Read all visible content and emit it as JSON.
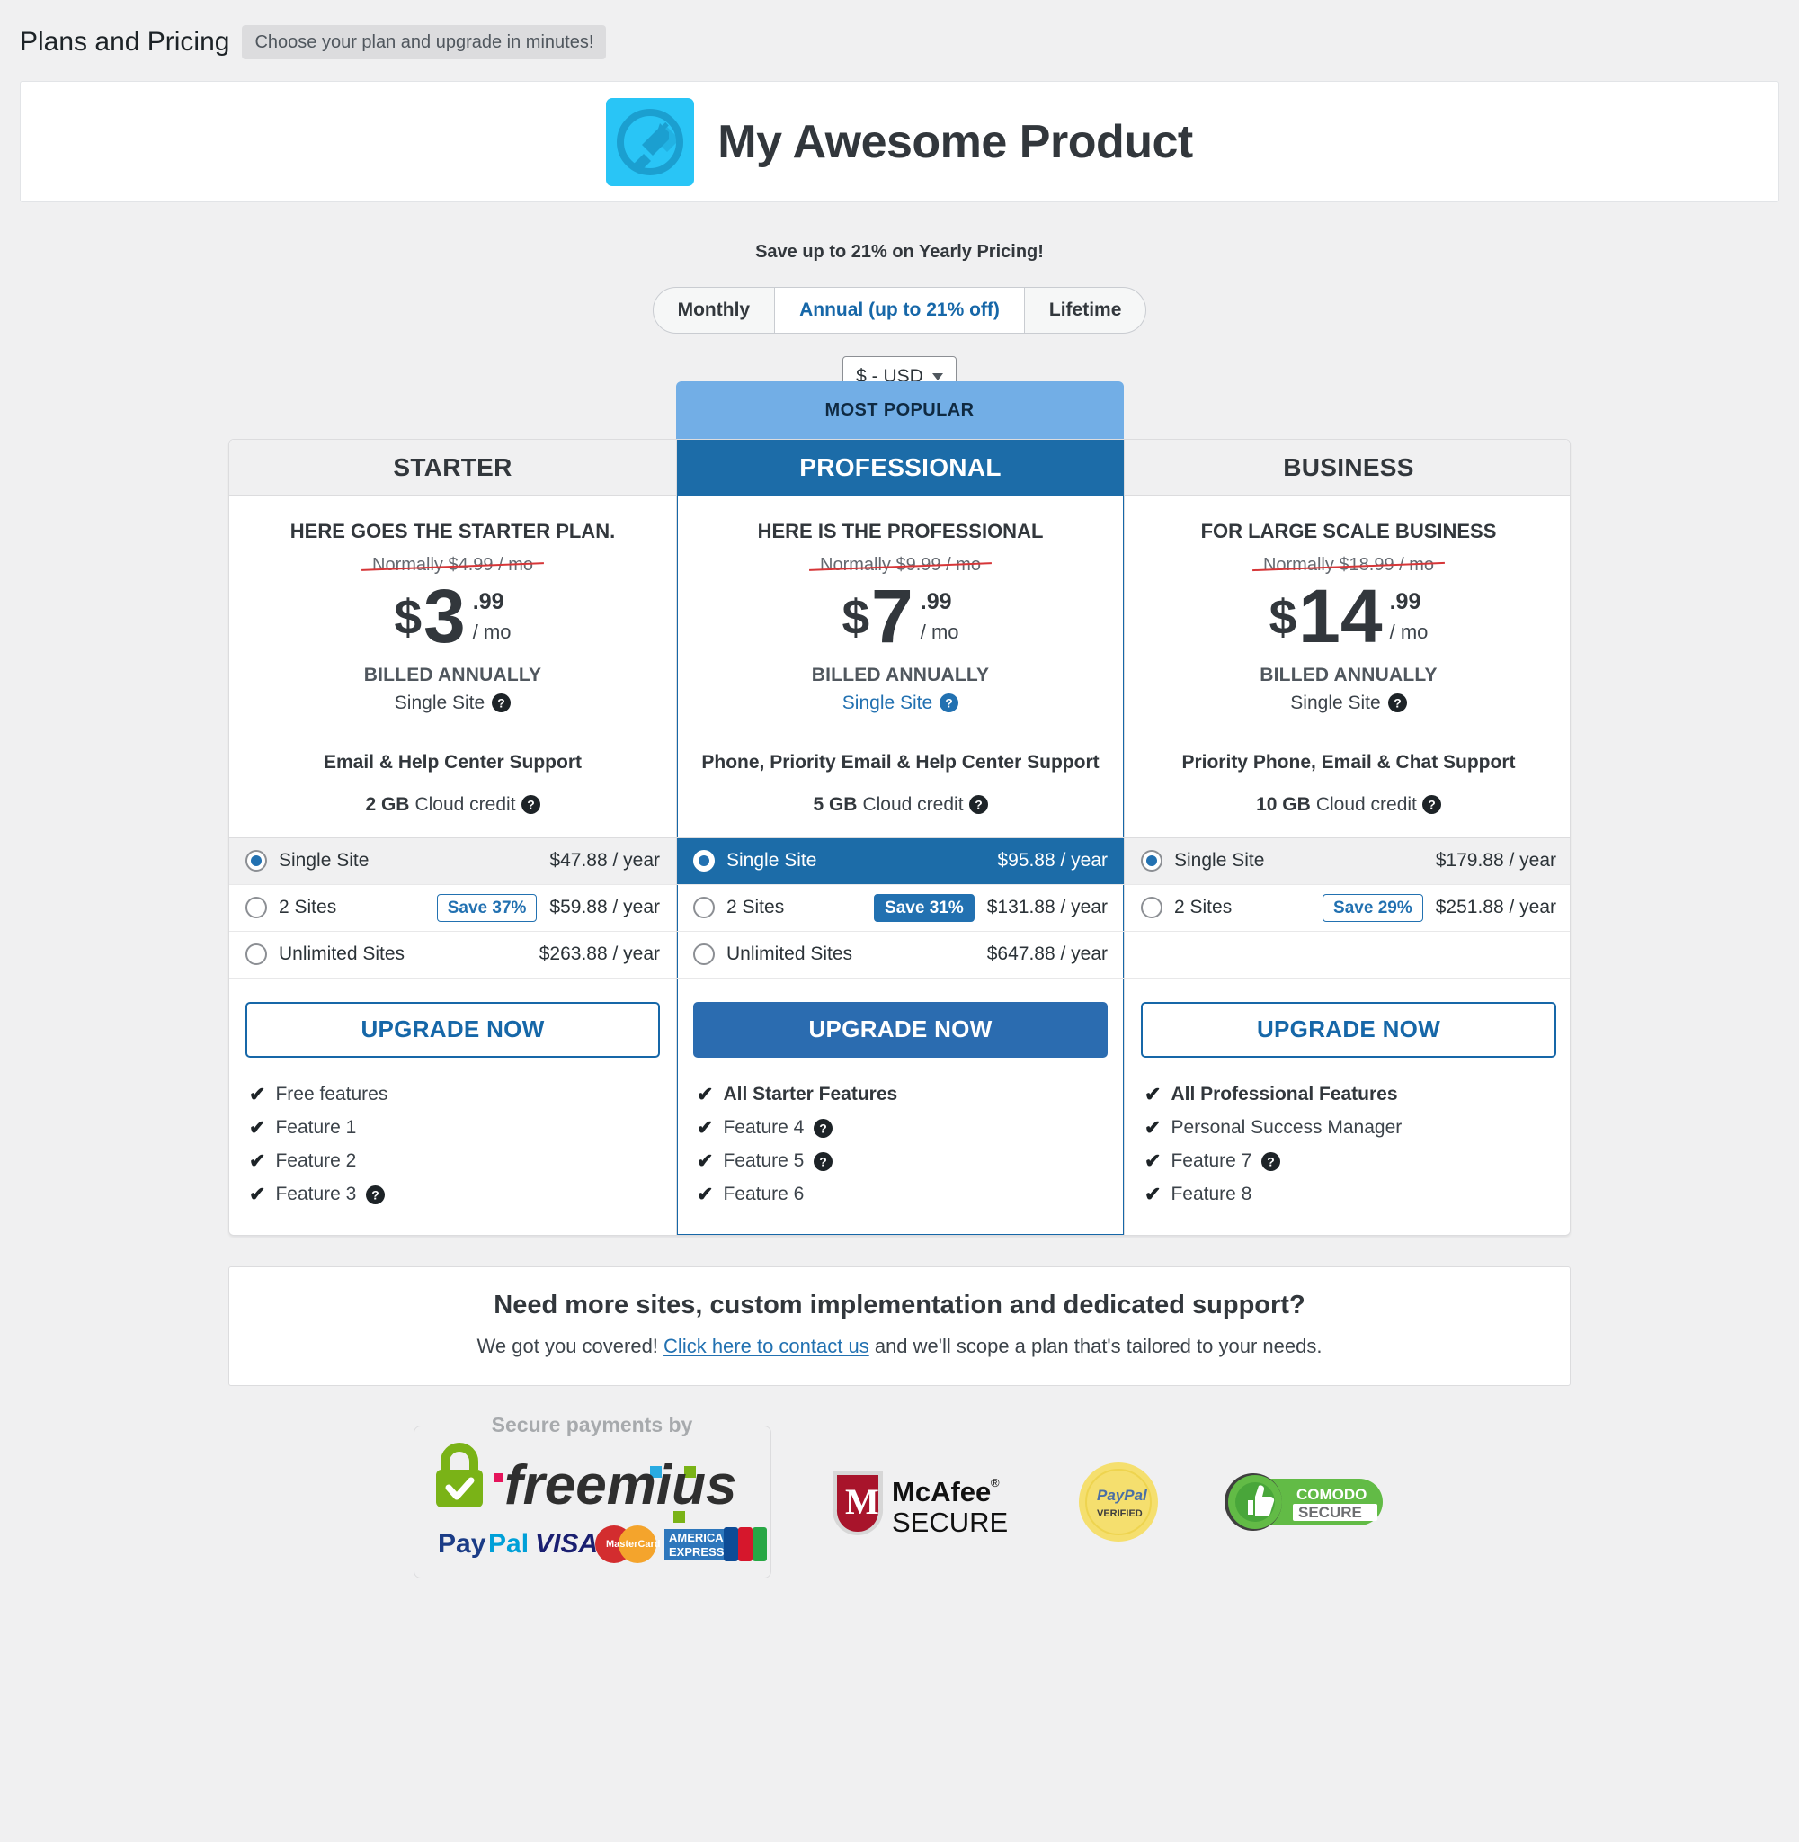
{
  "page": {
    "title": "Plans and Pricing",
    "subtitle_pill": "Choose your plan and upgrade in minutes!"
  },
  "product": {
    "name": "My Awesome Product",
    "logo_icon": "plug-icon",
    "logo_bg": "#29c5f6"
  },
  "save_banner": "Save up to 21% on Yearly Pricing!",
  "billing_cycles": [
    {
      "label": "Monthly",
      "selected": false
    },
    {
      "label": "Annual (up to 21% off)",
      "selected": true
    },
    {
      "label": "Lifetime",
      "selected": false
    }
  ],
  "currency": {
    "value": "$ - USD",
    "icon": "chevron-down-icon"
  },
  "ribbon": {
    "label": "MOST POPULAR",
    "color": "#72aee6"
  },
  "accent_color": "#2271b1",
  "plans": [
    {
      "name": "STARTER",
      "featured": false,
      "description": "HERE GOES THE STARTER PLAN.",
      "normally": "Normally $4.99 / mo",
      "price_currency": "$",
      "price_integer": "3",
      "price_fraction": ".99",
      "price_period": "/ mo",
      "billed": "BILLED ANNUALLY",
      "license_label": "Single Site",
      "support": "Email & Help Center Support",
      "credit_amount": "2 GB",
      "credit_label": "Cloud credit",
      "licenses": [
        {
          "label": "Single Site",
          "badge": "",
          "price": "$47.88 / year",
          "selected": true
        },
        {
          "label": "2 Sites",
          "badge": "Save 37%",
          "price": "$59.88 / year",
          "selected": false
        },
        {
          "label": "Unlimited Sites",
          "badge": "",
          "price": "$263.88 / year",
          "selected": false
        }
      ],
      "cta": "UPGRADE NOW",
      "features": [
        {
          "text": "Free features",
          "strong": false,
          "help": false
        },
        {
          "text": "Feature 1",
          "strong": false,
          "help": false
        },
        {
          "text": "Feature 2",
          "strong": false,
          "help": false
        },
        {
          "text": "Feature 3",
          "strong": false,
          "help": true
        }
      ]
    },
    {
      "name": "PROFESSIONAL",
      "featured": true,
      "description": "HERE IS THE PROFESSIONAL",
      "normally": "Normally $9.99 / mo",
      "price_currency": "$",
      "price_integer": "7",
      "price_fraction": ".99",
      "price_period": "/ mo",
      "billed": "BILLED ANNUALLY",
      "license_label": "Single Site",
      "support": "Phone, Priority Email & Help Center Support",
      "credit_amount": "5 GB",
      "credit_label": "Cloud credit",
      "licenses": [
        {
          "label": "Single Site",
          "badge": "",
          "price": "$95.88 / year",
          "selected": true
        },
        {
          "label": "2 Sites",
          "badge": "Save 31%",
          "price": "$131.88 / year",
          "selected": false
        },
        {
          "label": "Unlimited Sites",
          "badge": "",
          "price": "$647.88 / year",
          "selected": false
        }
      ],
      "cta": "UPGRADE NOW",
      "features": [
        {
          "text": "All Starter Features",
          "strong": true,
          "help": false
        },
        {
          "text": "Feature 4",
          "strong": false,
          "help": true
        },
        {
          "text": "Feature 5",
          "strong": false,
          "help": true
        },
        {
          "text": "Feature 6",
          "strong": false,
          "help": false
        }
      ]
    },
    {
      "name": "BUSINESS",
      "featured": false,
      "description": "FOR LARGE SCALE BUSINESS",
      "normally": "Normally $18.99 / mo",
      "price_currency": "$",
      "price_integer": "14",
      "price_fraction": ".99",
      "price_period": "/ mo",
      "billed": "BILLED ANNUALLY",
      "license_label": "Single Site",
      "support": "Priority Phone, Email & Chat Support",
      "credit_amount": "10 GB",
      "credit_label": "Cloud credit",
      "licenses": [
        {
          "label": "Single Site",
          "badge": "",
          "price": "$179.88 / year",
          "selected": true
        },
        {
          "label": "2 Sites",
          "badge": "Save 29%",
          "price": "$251.88 / year",
          "selected": false
        }
      ],
      "cta": "UPGRADE NOW",
      "features": [
        {
          "text": "All Professional Features",
          "strong": true,
          "help": false
        },
        {
          "text": "Personal Success Manager",
          "strong": false,
          "help": false
        },
        {
          "text": "Feature 7",
          "strong": false,
          "help": true
        },
        {
          "text": "Feature 8",
          "strong": false,
          "help": false
        }
      ]
    }
  ],
  "contact": {
    "heading": "Need more sites, custom implementation and dedicated support?",
    "text_before": "We got you covered! ",
    "link": "Click here to contact us",
    "text_after": " and we'll scope a plan that's tailored to your needs."
  },
  "payments": {
    "secure_caption": "Secure payments by",
    "processor": "freemius",
    "methods": [
      "PayPal",
      "VISA",
      "MasterCard",
      "AMERICAN EXPRESS",
      "JCB"
    ],
    "badges": [
      {
        "name": "McAfee SECURE",
        "line1": "McAfee",
        "line2": "SECURE"
      },
      {
        "name": "PayPal VERIFIED",
        "line1": "PayPal",
        "line2": "VERIFIED"
      },
      {
        "name": "COMODO SECURE",
        "line1": "COMODO",
        "line2": "SECURE"
      }
    ]
  }
}
